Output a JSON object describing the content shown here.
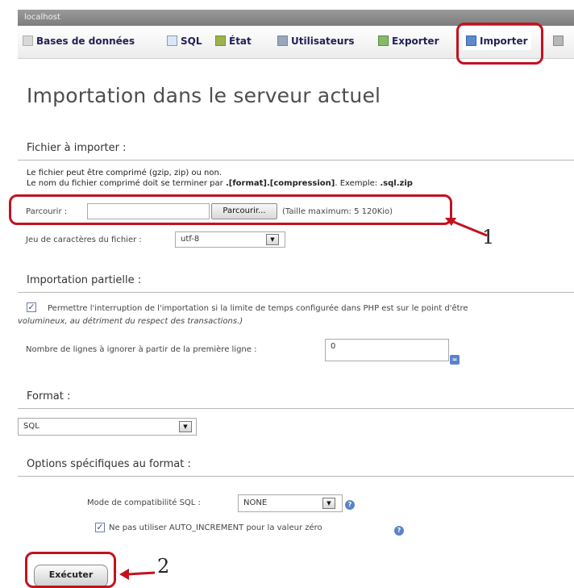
{
  "topbar": {
    "server": "localhost"
  },
  "tabs": [
    {
      "label": "Bases de données",
      "icon": "database-icon"
    },
    {
      "label": "SQL",
      "icon": "sql-icon"
    },
    {
      "label": "État",
      "icon": "status-icon"
    },
    {
      "label": "Utilisateurs",
      "icon": "users-icon"
    },
    {
      "label": "Exporter",
      "icon": "export-icon"
    },
    {
      "label": "Importer",
      "icon": "import-icon",
      "active": true
    },
    {
      "label": "",
      "icon": "wrench-icon"
    }
  ],
  "page": {
    "title": "Importation dans le serveur actuel"
  },
  "file_section": {
    "heading": "Fichier à importer :",
    "line1": "Le fichier peut être comprimé (gzip, zip) ou non.",
    "line2_prefix": "Le nom du fichier comprimé doit se terminer par ",
    "line2_pattern": ".[format].[compression]",
    "line2_middle": ". Exemple: ",
    "line2_example": ".sql.zip",
    "browse_label": "Parcourir :",
    "browse_button": "Parcourir...",
    "max_size": "(Taille maximum: 5 120Kio)",
    "charset_label": "Jeu de caractères du fichier :",
    "charset_value": "utf-8"
  },
  "partial_section": {
    "heading": "Importation partielle :",
    "interrupt_text": "Permettre l'interruption de l'importation si la limite de temps configurée dans PHP est sur le point d'être",
    "interrupt_text2": "volumineux, au détriment du respect des transactions.)",
    "interrupt_checked": true,
    "skip_label": "Nombre de lignes à ignorer à partir de la première ligne :",
    "skip_value": "0"
  },
  "format_section": {
    "heading": "Format :",
    "value": "SQL"
  },
  "options_section": {
    "heading": "Options spécifiques au format :",
    "compat_label": "Mode de compatibilité SQL :",
    "compat_value": "NONE",
    "auto_inc_label": "Ne pas utiliser AUTO_INCREMENT pour la valeur zéro",
    "auto_inc_checked": true
  },
  "execute_button": "Exécuter",
  "annotations": {
    "n1": "1",
    "n2": "2"
  },
  "colors": {
    "callout": "#c2121f",
    "tab_text": "#222255",
    "title": "#4d4d4d"
  }
}
